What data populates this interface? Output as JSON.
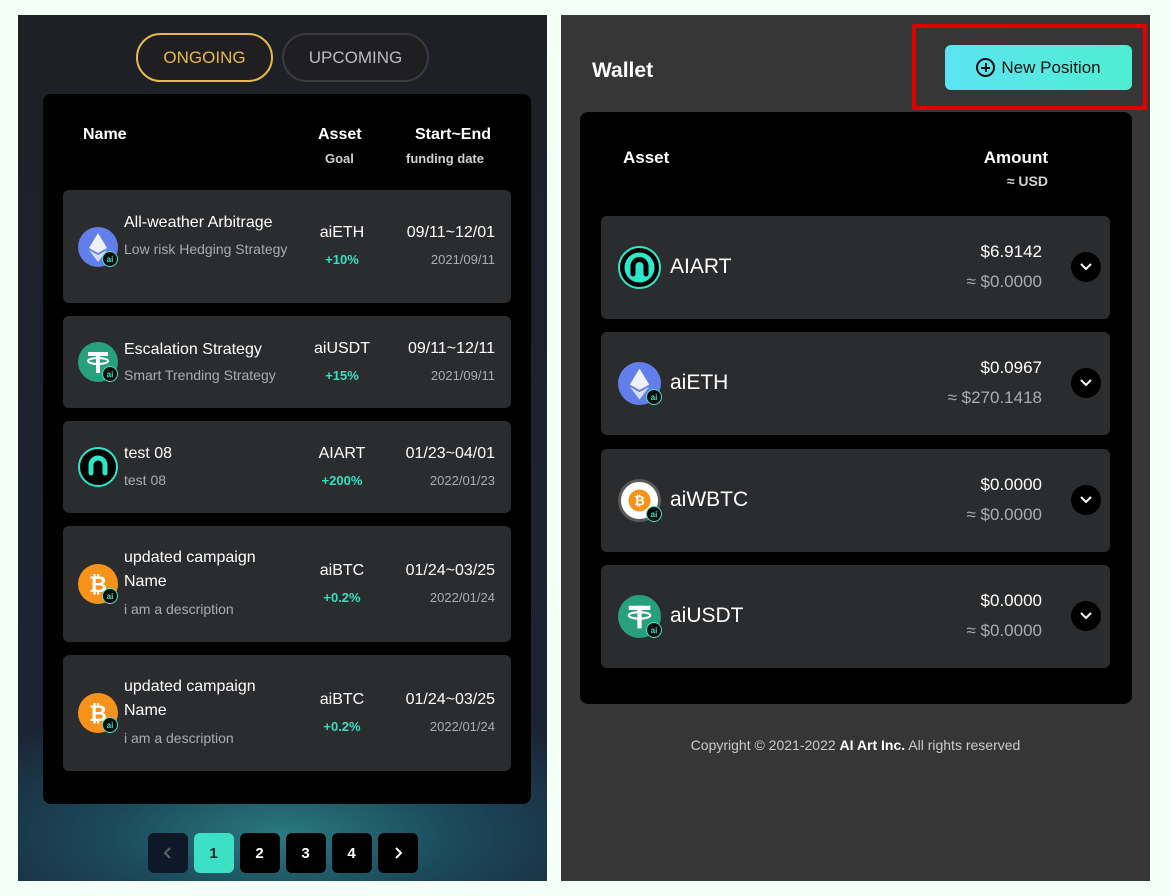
{
  "campaigns": {
    "tabs": [
      {
        "label": "ONGOING",
        "active": true
      },
      {
        "label": "UPCOMING",
        "active": false
      }
    ],
    "columns": {
      "name": "Name",
      "asset": "Asset",
      "asset_sub": "Goal",
      "date": "Start~End",
      "date_sub": "funding date"
    },
    "rows": [
      {
        "title": "All-weather Arbitrage",
        "desc": "Low risk Hedging Strategy",
        "asset": "aiETH",
        "goal": "+10%",
        "range": "09/11~12/01",
        "date": "2021/09/11",
        "icon": "ethereum-icon",
        "color": "#627eea"
      },
      {
        "title": "Escalation Strategy",
        "desc": "Smart Trending Strategy",
        "asset": "aiUSDT",
        "goal": "+15%",
        "range": "09/11~12/11",
        "date": "2021/09/11",
        "icon": "tether-icon",
        "color": "#26a17b"
      },
      {
        "title": "test 08",
        "desc": "test 08",
        "asset": "AIART",
        "goal": "+200%",
        "range": "01/23~04/01",
        "date": "2022/01/23",
        "icon": "aiart-icon",
        "color": "#2ee6c9"
      },
      {
        "title": "updated campaign Name",
        "desc": "i am a description",
        "asset": "aiBTC",
        "goal": "+0.2%",
        "range": "01/24~03/25",
        "date": "2022/01/24",
        "icon": "bitcoin-icon",
        "color": "#f7931a"
      },
      {
        "title": "updated campaign Name",
        "desc": "i am a description",
        "asset": "aiBTC",
        "goal": "+0.2%",
        "range": "01/24~03/25",
        "date": "2022/01/24",
        "icon": "bitcoin-icon",
        "color": "#f7931a"
      }
    ],
    "pagination": {
      "pages": [
        "1",
        "2",
        "3",
        "4"
      ],
      "current": "1",
      "prev_icon": "chevron-left-icon",
      "next_icon": "chevron-right-icon"
    }
  },
  "wallet": {
    "title": "Wallet",
    "new_position_label": "New Position",
    "columns": {
      "asset": "Asset",
      "amount": "Amount",
      "amount_sub": "≈ USD"
    },
    "rows": [
      {
        "name": "AIART",
        "amount": "$6.9142",
        "usd": "≈ $0.0000",
        "icon": "aiart-icon"
      },
      {
        "name": "aiETH",
        "amount": "$0.0967",
        "usd": "≈ $270.1418",
        "icon": "ethereum-icon"
      },
      {
        "name": "aiWBTC",
        "amount": "$0.0000",
        "usd": "≈ $0.0000",
        "icon": "wbtc-icon"
      },
      {
        "name": "aiUSDT",
        "amount": "$0.0000",
        "usd": "≈ $0.0000",
        "icon": "tether-icon"
      }
    ]
  },
  "footer": {
    "copyright_prefix": "Copyright © 2021-2022 ",
    "company": "AI Art Inc.",
    "copyright_suffix": " All rights reserved"
  },
  "colors": {
    "accent_gold": "#eab84b",
    "accent_teal": "#35e0c1",
    "highlight_red": "#e00000"
  }
}
